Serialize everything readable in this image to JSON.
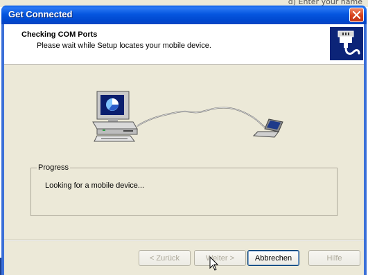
{
  "background": {
    "text": "d)  Enter your name"
  },
  "window": {
    "title": "Get Connected"
  },
  "header": {
    "title": "Checking COM Ports",
    "subtitle": "Please wait while Setup locates your mobile device."
  },
  "progress": {
    "label": "Progress",
    "status": "Looking for a mobile device..."
  },
  "buttons": {
    "back": "< Zurück",
    "next": "Weiter >",
    "cancel": "Abbrechen",
    "help": "Hilfe"
  },
  "colors": {
    "titlebar": "#0058e6",
    "dialog_bg": "#ece9d8",
    "header_icon_bg": "#0c2478"
  },
  "icons": {
    "header": "serial-connector-icon",
    "close": "close-icon"
  }
}
